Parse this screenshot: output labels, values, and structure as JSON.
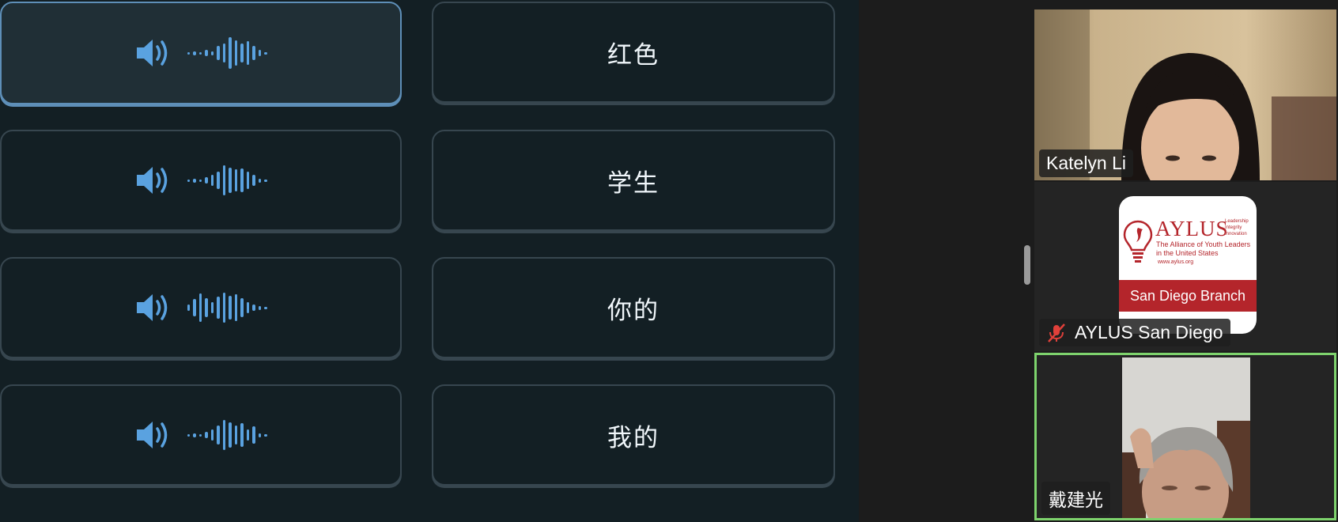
{
  "exercise": {
    "audio_cards": [
      {
        "label": "audio-clip-1",
        "wave": [
          3,
          5,
          3,
          8,
          5,
          18,
          24,
          40,
          32,
          24,
          30,
          18,
          8,
          3
        ]
      },
      {
        "label": "audio-clip-2",
        "wave": [
          3,
          5,
          3,
          8,
          14,
          22,
          38,
          32,
          28,
          30,
          22,
          14,
          5,
          3
        ]
      },
      {
        "label": "audio-clip-3",
        "wave": [
          8,
          22,
          36,
          24,
          14,
          28,
          38,
          30,
          34,
          24,
          14,
          8,
          5,
          3
        ]
      },
      {
        "label": "audio-clip-4",
        "wave": [
          3,
          5,
          3,
          8,
          14,
          24,
          38,
          32,
          24,
          30,
          14,
          22,
          5,
          3
        ]
      }
    ],
    "word_cards": [
      "红色",
      "学生",
      "你的",
      "我的"
    ],
    "selected_index": 0
  },
  "meeting": {
    "participants": [
      {
        "name": "Katelyn Li",
        "muted": false
      },
      {
        "name": "AYLUS San Diego",
        "muted": true
      },
      {
        "name": "戴建光",
        "muted": false,
        "active_speaker": true
      }
    ],
    "aylus_logo": {
      "title": "AYLUS",
      "tagline": [
        "Leadership",
        "Integrity",
        "Innovation"
      ],
      "org_line1": "The Alliance of Youth Leaders",
      "org_line2": "in the United States",
      "url": "www.aylus.org",
      "branch": "San Diego Branch"
    }
  },
  "colors": {
    "accent_blue": "#5aa2e0",
    "selected_border": "#5e8fb8",
    "active_speaker_border": "#7ed36d",
    "aylus_red": "#b4252b"
  }
}
